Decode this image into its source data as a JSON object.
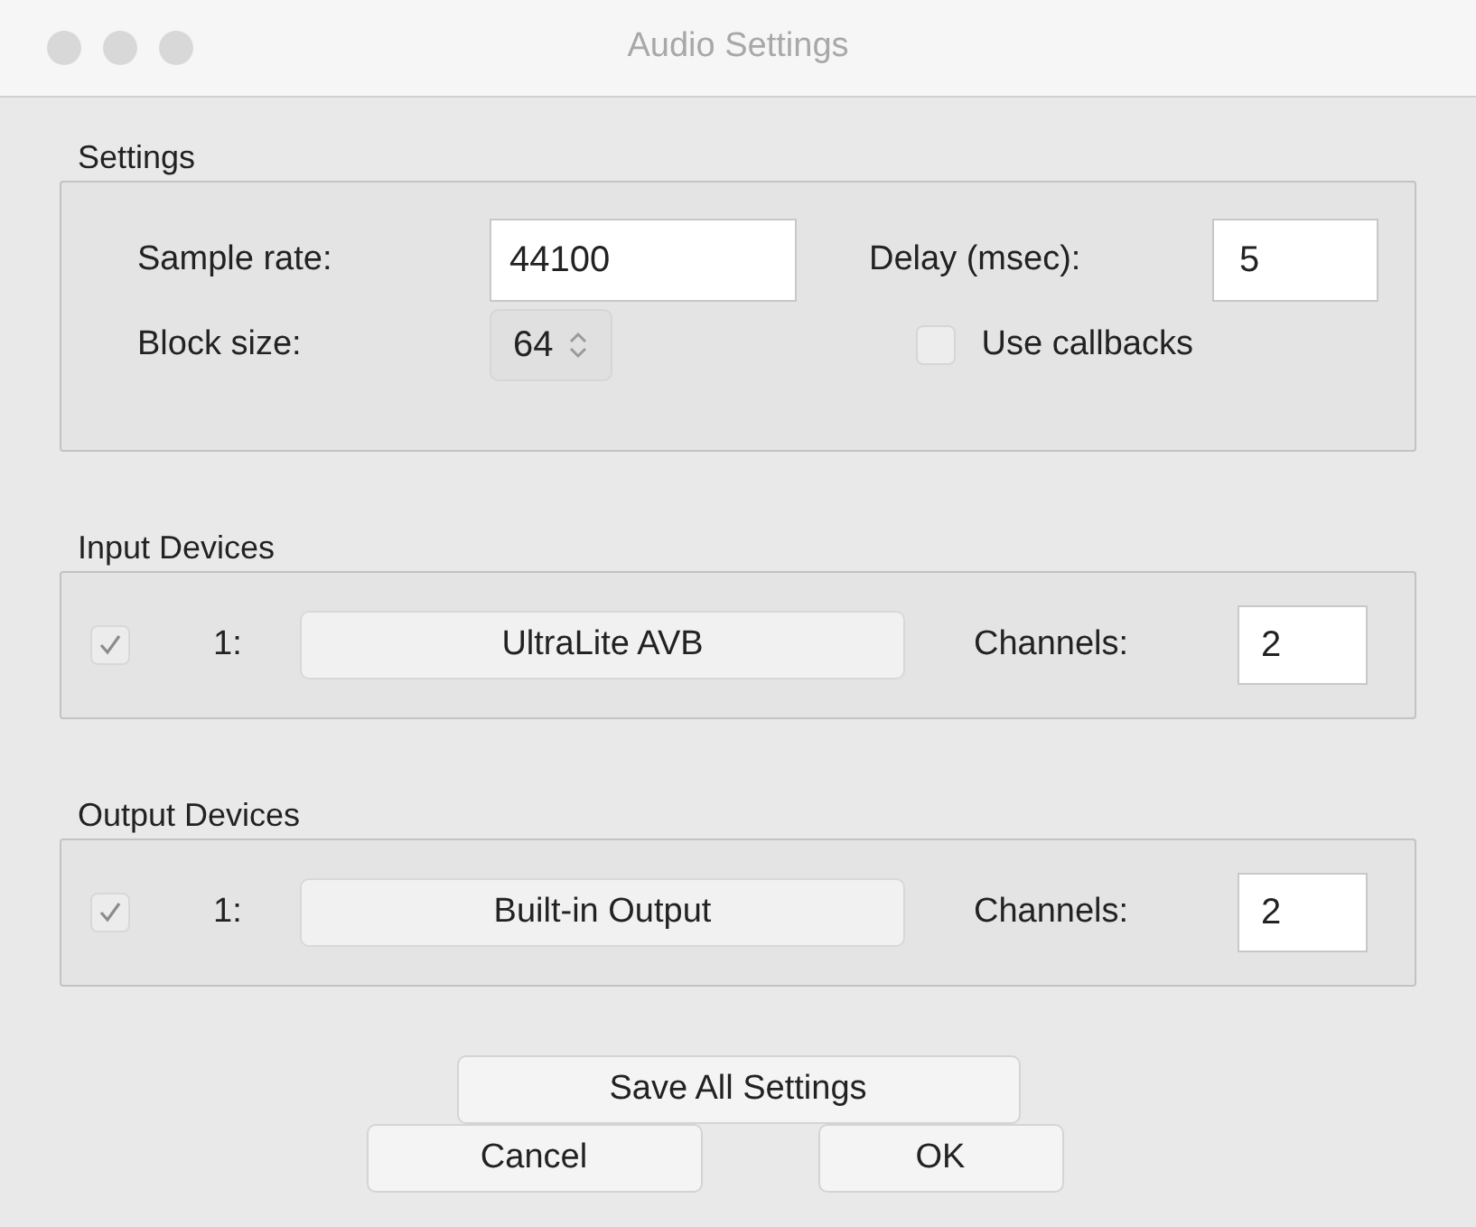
{
  "window": {
    "title": "Audio Settings"
  },
  "settings": {
    "title": "Settings",
    "sample_rate": {
      "label": "Sample rate:",
      "value": "44100"
    },
    "delay": {
      "label": "Delay (msec):",
      "value": "5"
    },
    "block_size": {
      "label": "Block size:",
      "value": "64"
    },
    "use_callbacks": {
      "label": "Use callbacks",
      "checked": false
    }
  },
  "device_groups": [
    {
      "title": "Input Devices",
      "devices": [
        {
          "checked": true,
          "disabled": true,
          "index": "1:",
          "name": "UltraLite AVB",
          "channels_label": "Channels:",
          "channels": "2"
        }
      ]
    },
    {
      "title": "Output Devices",
      "devices": [
        {
          "checked": true,
          "disabled": true,
          "index": "1:",
          "name": "Built-in Output",
          "channels_label": "Channels:",
          "channels": "2"
        }
      ]
    }
  ],
  "buttons": {
    "save": "Save All Settings",
    "cancel": "Cancel",
    "ok": "OK"
  }
}
